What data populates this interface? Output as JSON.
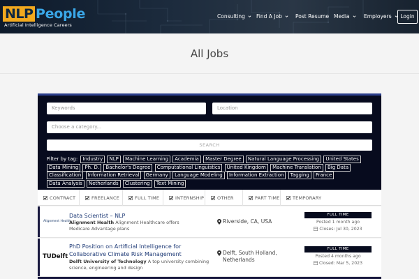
{
  "header": {
    "logo_nlp": "NLP",
    "logo_people": "People",
    "logo_sub": "Artificial Intelligence Careers",
    "nav": [
      {
        "label": "Consulting",
        "has_caret": true
      },
      {
        "label": "Find A Job",
        "has_caret": true
      },
      {
        "label": "Post Resume",
        "has_caret": false
      },
      {
        "label": "Media",
        "has_caret": true
      },
      {
        "label": "Employers",
        "has_caret": true
      }
    ],
    "login_label": "Login"
  },
  "page": {
    "title": "All Jobs"
  },
  "search": {
    "keywords_placeholder": "Keywords",
    "location_placeholder": "Location",
    "category_placeholder": "Choose a category...",
    "button_label": "SEARCH",
    "filter_label": "Filter by tag:",
    "tags": [
      "Industry",
      "NLP",
      "Machine Learning",
      "Academia",
      "Master Degree",
      "Natural Language Processing",
      "United States",
      "Data Mining",
      "Ph. D.",
      "Bachelor's Degree",
      "Computational Linguistics",
      "United Kingdom",
      "Machine Translation",
      "Big Data",
      "Classification",
      "Information Retrieval",
      "Germany",
      "Language Modeling",
      "Information Extraction",
      "Tagging",
      "France",
      "Data Analysis",
      "Netherlands",
      "Clustering",
      "Text Mining"
    ]
  },
  "job_types": [
    "CONTRACT",
    "FREELANCE",
    "FULL TIME",
    "INTERNSHIP",
    "OTHER",
    "PART TIME",
    "TEMPORARY"
  ],
  "jobs": [
    {
      "logo_text": "Alignment Health",
      "title": "Data Scientist – NLP",
      "company": "Alignment Health",
      "description": "Alignment Healthcare offers Medicare Advantage plans",
      "location": "Riverside, CA, USA",
      "type": "FULL TIME",
      "posted": "Posted 1 month ago",
      "closes": "Closes: Jul 30, 2023"
    },
    {
      "logo_text": "TUDelft",
      "title": "PhD Position on Artificial Intelligence for Collaborative Climate Risk Management",
      "company": "Delft University of Technology",
      "description": "A top university combining science, engineering and design",
      "location": "Delft, South Holland, Netherlands",
      "type": "FULL TIME",
      "posted": "Posted 4 months ago",
      "closes": "Closed: Mar 5, 2023"
    }
  ],
  "colors": {
    "accent_orange": "#f2a91e",
    "accent_blue": "#3aa7e8",
    "panel_dark": "#070b1e",
    "link_blue": "#1e3a76"
  }
}
